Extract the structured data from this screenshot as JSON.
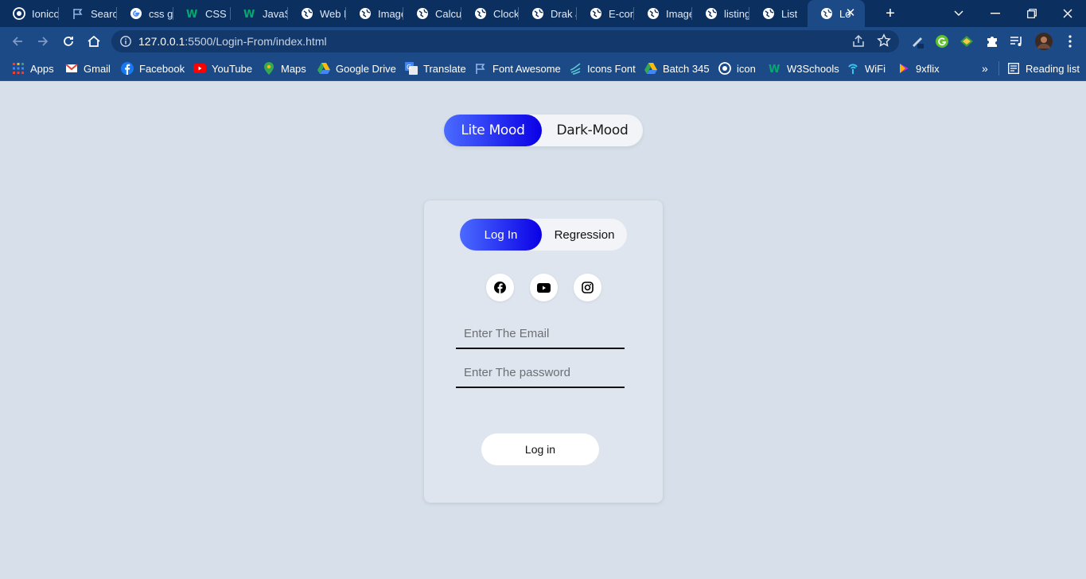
{
  "browser": {
    "tabs": [
      {
        "title": "Ionico",
        "icon": "ionic-icon"
      },
      {
        "title": "Search",
        "icon": "flag-icon"
      },
      {
        "title": "css gri",
        "icon": "google-icon"
      },
      {
        "title": "CSS G",
        "icon": "w3schools-icon"
      },
      {
        "title": "JavaSc",
        "icon": "w3schools-icon"
      },
      {
        "title": "Web D",
        "icon": "globe-icon"
      },
      {
        "title": "Image",
        "icon": "globe-icon"
      },
      {
        "title": "Calcul",
        "icon": "globe-icon"
      },
      {
        "title": "Clock",
        "icon": "globe-icon"
      },
      {
        "title": "Drak a",
        "icon": "globe-icon"
      },
      {
        "title": "E-com",
        "icon": "globe-icon"
      },
      {
        "title": "Image",
        "icon": "globe-icon"
      },
      {
        "title": "listing",
        "icon": "globe-icon"
      },
      {
        "title": "List",
        "icon": "globe-icon"
      },
      {
        "title": "Lo",
        "icon": "globe-icon",
        "active": true
      }
    ],
    "url_host": "127.0.0.1",
    "url_rest": ":5500/Login-From/index.html",
    "bookmarks": [
      {
        "label": "Apps",
        "icon": "apps-grid-icon"
      },
      {
        "label": "Gmail",
        "icon": "gmail-icon"
      },
      {
        "label": "Facebook",
        "icon": "facebook-icon"
      },
      {
        "label": "YouTube",
        "icon": "youtube-icon"
      },
      {
        "label": "Maps",
        "icon": "maps-pin-icon"
      },
      {
        "label": "Google Drive",
        "icon": "google-drive-icon"
      },
      {
        "label": "Translate",
        "icon": "translate-icon"
      },
      {
        "label": "Font Awesome",
        "icon": "flag-icon"
      },
      {
        "label": "Icons Font",
        "icon": "icons-font-icon"
      },
      {
        "label": "Batch 345",
        "icon": "google-drive-icon"
      },
      {
        "label": "icon",
        "icon": "ionic-icon"
      },
      {
        "label": "W3Schools",
        "icon": "w3schools-icon"
      },
      {
        "label": "WiFi",
        "icon": "wifi-icon"
      },
      {
        "label": "9xflix",
        "icon": "play-icon"
      }
    ],
    "reading_list": "Reading list",
    "colors": {
      "frame": "#0b2f5e",
      "toolbar": "#1b4a86",
      "page": "#d7e0ea"
    }
  },
  "page": {
    "mood_toggle": {
      "lite": "Lite Mood",
      "dark": "Dark-Mood"
    },
    "auth_toggle": {
      "login": "Log In",
      "register": "Regression"
    },
    "social": [
      "facebook-icon",
      "youtube-icon",
      "instagram-icon"
    ],
    "email_placeholder": "Enter The Email",
    "password_placeholder": "Enter The password",
    "submit_label": "Log in",
    "accent_gradient": [
      "#4b6bff",
      "#0a00e6"
    ]
  }
}
